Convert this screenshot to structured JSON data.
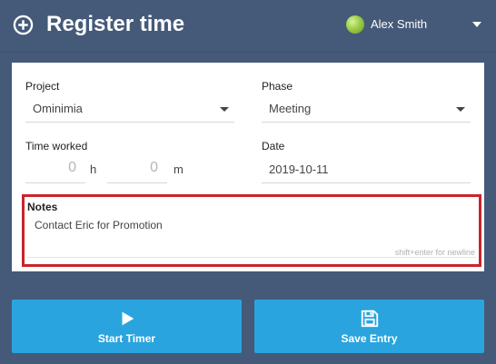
{
  "header": {
    "title": "Register time",
    "user_name": "Alex Smith"
  },
  "form": {
    "project": {
      "label": "Project",
      "value": "Ominimia"
    },
    "phase": {
      "label": "Phase",
      "value": "Meeting"
    },
    "time_worked": {
      "label": "Time worked",
      "hours": "0",
      "hours_unit": "h",
      "minutes": "0",
      "minutes_unit": "m"
    },
    "date": {
      "label": "Date",
      "value": "2019-10-11"
    },
    "notes": {
      "label": "Notes",
      "value": "Contact Eric for Promotion",
      "hint": "shift+enter for newline"
    }
  },
  "buttons": {
    "start_timer": "Start Timer",
    "save_entry": "Save Entry"
  },
  "colors": {
    "background": "#455a79",
    "button": "#2aa4de",
    "highlight_border": "#c9242a"
  },
  "icons": {
    "header": "plus-circle-icon",
    "start_timer": "play-icon",
    "save_entry": "floppy-disk-icon"
  }
}
